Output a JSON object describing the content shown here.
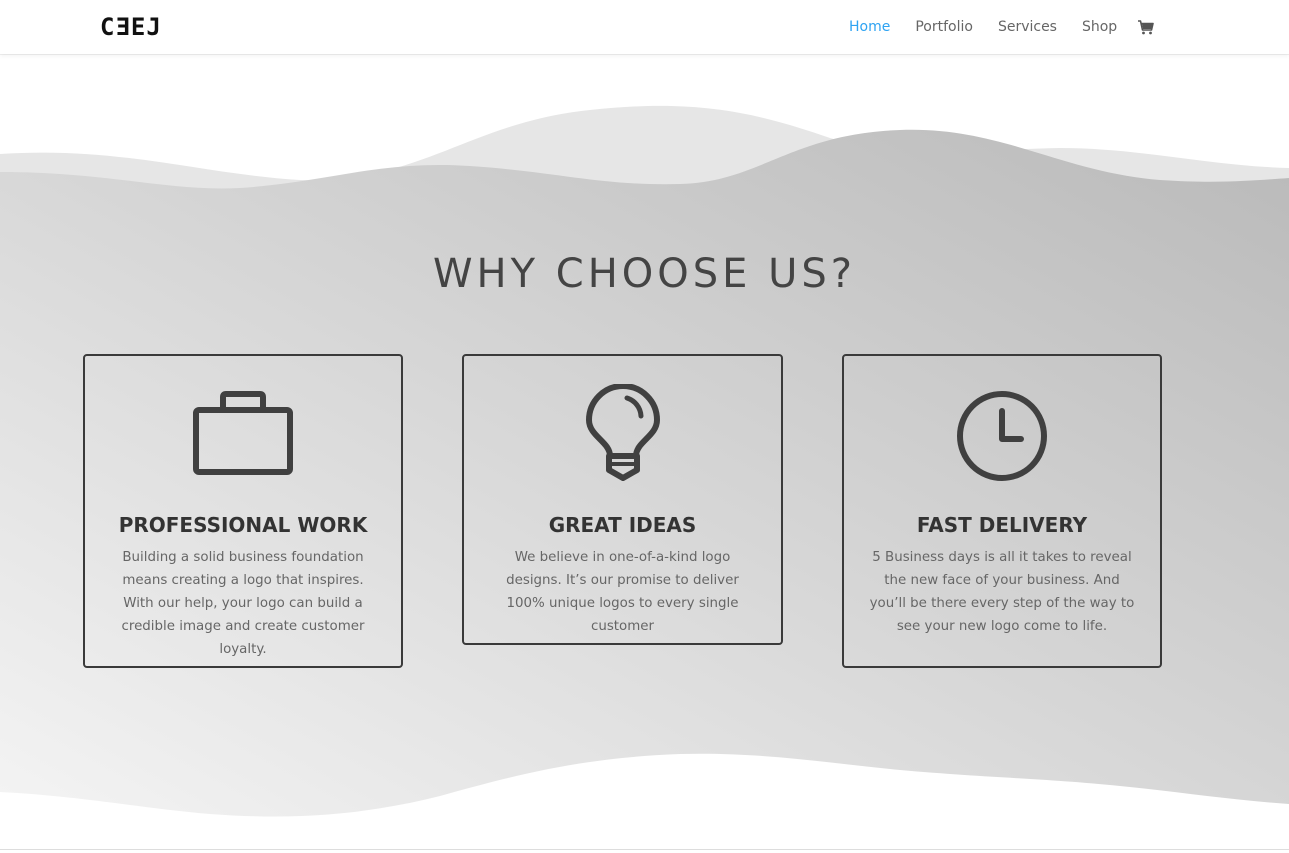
{
  "header": {
    "logo_text": "CƎEJ",
    "nav": [
      {
        "label": "Home",
        "active": true
      },
      {
        "label": "Portfolio",
        "active": false
      },
      {
        "label": "Services",
        "active": false
      },
      {
        "label": "Shop",
        "active": false
      }
    ],
    "cart_icon": "shopping-cart-icon",
    "active_color": "#2ea3f2"
  },
  "section": {
    "heading": "WHY CHOOSE US?",
    "cards": [
      {
        "icon": "briefcase-icon",
        "title": "PROFESSIONAL WORK",
        "text": "Building a solid business foundation means creating a logo that inspires. With our help, your logo can build a credible image and create customer loyalty."
      },
      {
        "icon": "lightbulb-icon",
        "title": "GREAT IDEAS",
        "text": "We believe in one-of-a-kind logo designs. It’s our promise to deliver 100% unique logos to every single customer"
      },
      {
        "icon": "clock-icon",
        "title": "FAST DELIVERY",
        "text": "5 Business days is all it takes to reveal the new face of your business. And you’ll be there every step of the way to see your new logo come to life."
      }
    ]
  }
}
